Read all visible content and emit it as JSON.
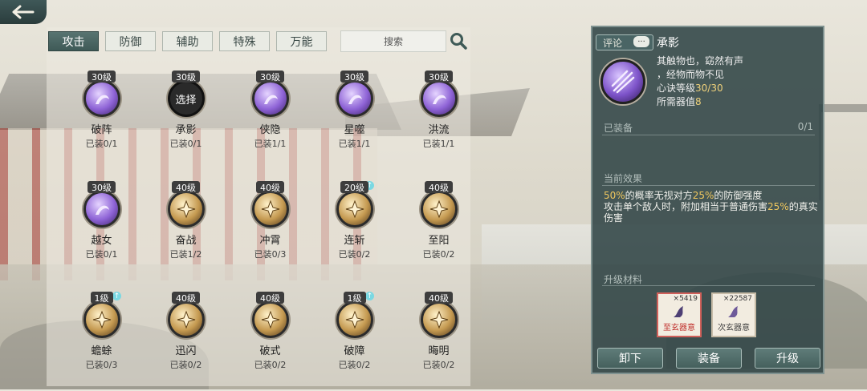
{
  "nav": {
    "back_icon": "arrow-left-icon"
  },
  "tabs": [
    {
      "label": "攻击",
      "active": true
    },
    {
      "label": "防御",
      "active": false
    },
    {
      "label": "辅助",
      "active": false
    },
    {
      "label": "特殊",
      "active": false
    },
    {
      "label": "万能",
      "active": false
    }
  ],
  "search": {
    "placeholder": "搜索",
    "icon": "search-icon"
  },
  "skills": [
    {
      "level": "30级",
      "name": "破阵",
      "equipped": "已装0/1",
      "color": "purple",
      "icon": "vortex-icon"
    },
    {
      "level": "30级",
      "name": "承影",
      "equipped": "已装0/1",
      "color": "selected",
      "select_label": "选择",
      "icon": "select-icon"
    },
    {
      "level": "30级",
      "name": "侠隐",
      "equipped": "已装1/1",
      "color": "purple",
      "icon": "mist-icon"
    },
    {
      "level": "30级",
      "name": "星噬",
      "equipped": "已装1/1",
      "color": "purple",
      "icon": "star-icon"
    },
    {
      "level": "30级",
      "name": "洪流",
      "equipped": "已装1/1",
      "color": "purple",
      "icon": "wave-icon"
    },
    {
      "level": "30级",
      "name": "越女",
      "equipped": "已装0/1",
      "color": "purple",
      "icon": "crescent-icon"
    },
    {
      "level": "40级",
      "name": "奋战",
      "equipped": "已装1/2",
      "color": "gold",
      "icon": "fist-icon"
    },
    {
      "level": "40级",
      "name": "冲霄",
      "equipped": "已装0/3",
      "color": "gold",
      "icon": "swirl-icon"
    },
    {
      "level": "20级",
      "name": "连斩",
      "equipped": "已装0/2",
      "color": "gold",
      "upgrade": true,
      "icon": "slash-icon"
    },
    {
      "level": "40级",
      "name": "至阳",
      "equipped": "已装0/2",
      "color": "gold",
      "icon": "sun-icon"
    },
    {
      "level": "1级",
      "name": "蟾蜍",
      "equipped": "已装0/3",
      "color": "gold",
      "upgrade": true,
      "icon": "toad-icon"
    },
    {
      "level": "40级",
      "name": "迅闪",
      "equipped": "已装0/2",
      "color": "gold",
      "icon": "dash-icon"
    },
    {
      "level": "40级",
      "name": "破式",
      "equipped": "已装0/2",
      "color": "gold",
      "icon": "break-icon"
    },
    {
      "level": "1级",
      "name": "破障",
      "equipped": "已装0/2",
      "color": "gold",
      "upgrade": true,
      "icon": "fist-icon"
    },
    {
      "level": "40级",
      "name": "晦明",
      "equipped": "已装0/2",
      "color": "gold",
      "icon": "eye-icon"
    }
  ],
  "detail": {
    "comment_label": "评论",
    "comment_dots": "···",
    "title": "承影",
    "desc_line1": "其触物也，窈然有声",
    "desc_line2": "，经物而物不见",
    "req_label": "心诀等级",
    "req_value": "30/30",
    "cost_label": "所需器值",
    "cost_value": "8",
    "equipped_label": "已装备",
    "equipped_count": "0/1",
    "effect_label": "当前效果",
    "effect_p1_pct": "50%",
    "effect_p1_mid": "的概率无视对方",
    "effect_p1_pct2": "25%",
    "effect_p1_end": "的防御强度",
    "effect_p2_start": "攻击单个敌人时，附加相当于普通伤害",
    "effect_p2_pct": "25%",
    "effect_p2_end": "的真实伤害",
    "materials_label": "升级材料",
    "materials": [
      {
        "count": "×5419",
        "name": "至玄器意"
      },
      {
        "count": "×22587",
        "name": "次玄器意"
      }
    ],
    "buttons": {
      "unequip": "卸下",
      "equip": "装备",
      "upgrade": "升级"
    }
  }
}
